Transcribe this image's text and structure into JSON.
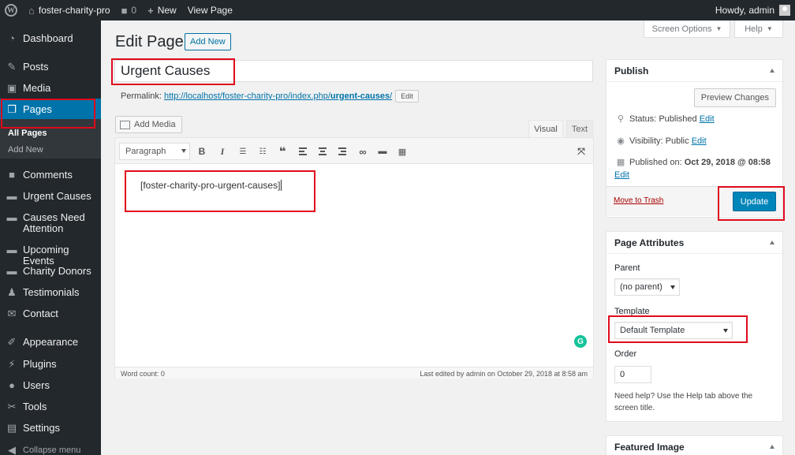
{
  "adminbar": {
    "site_name": "foster-charity-pro",
    "comments_count": "0",
    "new_label": "New",
    "view_page_label": "View Page",
    "howdy": "Howdy, admin"
  },
  "sidebar": {
    "items": [
      {
        "label": "Dashboard",
        "icon": "dashboard-icon"
      },
      {
        "label": "Posts",
        "icon": "pin-icon"
      },
      {
        "label": "Media",
        "icon": "media-icon"
      },
      {
        "label": "Pages",
        "icon": "pages-icon"
      },
      {
        "label": "Comments",
        "icon": "comments-icon"
      },
      {
        "label": "Urgent Causes",
        "icon": "folder-icon"
      },
      {
        "label": "Causes Need Attention",
        "icon": "folder-icon"
      },
      {
        "label": "Upcoming Events",
        "icon": "folder-icon"
      },
      {
        "label": "Charity Donors",
        "icon": "folder-icon"
      },
      {
        "label": "Testimonials",
        "icon": "users-icon"
      },
      {
        "label": "Contact",
        "icon": "mail-icon"
      },
      {
        "label": "Appearance",
        "icon": "brush-icon"
      },
      {
        "label": "Plugins",
        "icon": "plugin-icon"
      },
      {
        "label": "Users",
        "icon": "user-icon"
      },
      {
        "label": "Tools",
        "icon": "wrench-icon"
      },
      {
        "label": "Settings",
        "icon": "settings-icon"
      }
    ],
    "submenu": [
      "All Pages",
      "Add New"
    ],
    "collapse_label": "Collapse menu"
  },
  "screen_options": {
    "screen_options_label": "Screen Options",
    "help_label": "Help"
  },
  "header": {
    "title": "Edit Page",
    "add_new_label": "Add New"
  },
  "editor": {
    "post_title": "Urgent Causes",
    "permalink_label": "Permalink:",
    "permalink_base": "http://localhost/foster-charity-pro/index.php/",
    "permalink_slug": "urgent-causes",
    "permalink_end": "/",
    "edit_label": "Edit",
    "add_media_label": "Add Media",
    "tab_visual": "Visual",
    "tab_text": "Text",
    "format": "Paragraph",
    "content": "[foster-charity-pro-urgent-causes]",
    "word_count": "Word count: 0",
    "last_edited": "Last edited by admin on October 29, 2018 at 8:58 am"
  },
  "publish": {
    "title": "Publish",
    "preview_label": "Preview Changes",
    "status_label": "Status:",
    "status_value": "Published",
    "visibility_label": "Visibility:",
    "visibility_value": "Public",
    "published_label": "Published on:",
    "published_value": "Oct 29, 2018 @ 08:58",
    "edit_link": "Edit",
    "trash_label": "Move to Trash",
    "update_label": "Update"
  },
  "page_attributes": {
    "title": "Page Attributes",
    "parent_label": "Parent",
    "parent_value": "(no parent)",
    "template_label": "Template",
    "template_value": "Default Template",
    "order_label": "Order",
    "order_value": "0",
    "help_text": "Need help? Use the Help tab above the screen title."
  },
  "featured_image": {
    "title": "Featured Image"
  },
  "colors": {
    "accent": "#0073aa",
    "highlight": "#e10a1b",
    "admin_bar": "#23282d"
  }
}
